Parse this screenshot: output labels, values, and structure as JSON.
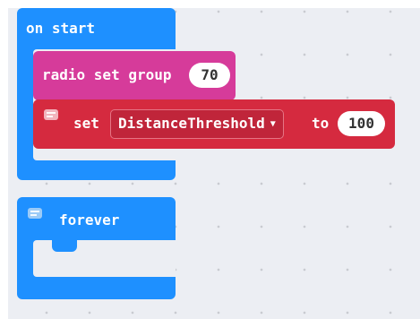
{
  "on_start": {
    "label": "on start"
  },
  "radio_block": {
    "label": "radio set group",
    "value": "70"
  },
  "set_block": {
    "label": "set",
    "variable": "DistanceThreshold",
    "to_label": "to",
    "value": "100"
  },
  "forever": {
    "label": "forever"
  },
  "colors": {
    "events": "#1e90ff",
    "radio": "#d63b9a",
    "variables": "#d52a3f",
    "workspace": "#eceef3"
  },
  "icons": {
    "comment": "comment-icon",
    "dropdown": "caret-down-icon"
  }
}
